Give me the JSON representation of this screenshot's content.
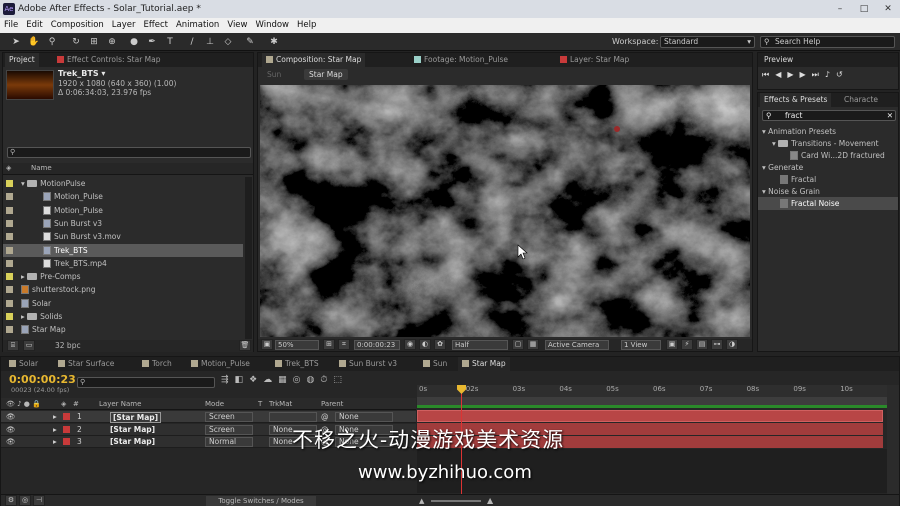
{
  "window": {
    "title": "Adobe After Effects - Solar_Tutorial.aep *",
    "logo": "Ae"
  },
  "menu": [
    "File",
    "Edit",
    "Composition",
    "Layer",
    "Effect",
    "Animation",
    "View",
    "Window",
    "Help"
  ],
  "toolbar": {
    "workspace_label": "Workspace:",
    "workspace_value": "Standard",
    "search_help": "Search Help"
  },
  "project": {
    "tab": "Project",
    "effect_controls_tab": "Effect Controls: Star Map",
    "item_name": "Trek_BTS ▾",
    "item_info1": "1920 x 1080  (640 x 360) (1.00)",
    "item_info2": "Δ 0:06:34:03, 23.976 fps",
    "name_header": "Name",
    "bpc": "32 bpc",
    "items": [
      {
        "label": "MotionPulse",
        "type": "folder",
        "color": "#d8d05a",
        "indent": 0
      },
      {
        "label": "Motion_Pulse",
        "type": "comp",
        "color": "#b0a890",
        "indent": 1
      },
      {
        "label": "Motion_Pulse",
        "type": "file",
        "color": "#b0a890",
        "indent": 1
      },
      {
        "label": "Sun Burst v3",
        "type": "comp",
        "color": "#b0a890",
        "indent": 1
      },
      {
        "label": "Sun Burst v3.mov",
        "type": "file",
        "color": "#b0a890",
        "indent": 1
      },
      {
        "label": "Trek_BTS",
        "type": "comp",
        "color": "#b0a890",
        "indent": 1,
        "selected": true
      },
      {
        "label": "Trek_BTS.mp4",
        "type": "file",
        "color": "#b0a890",
        "indent": 1
      },
      {
        "label": "Pre-Comps",
        "type": "folder",
        "color": "#d8d05a",
        "indent": 0
      },
      {
        "label": "shutterstock.png",
        "type": "image",
        "color": "#b0a890",
        "indent": 0
      },
      {
        "label": "Solar",
        "type": "comp",
        "color": "#b0a890",
        "indent": 0
      },
      {
        "label": "Solids",
        "type": "folder",
        "color": "#d8d05a",
        "indent": 0
      },
      {
        "label": "Star Map",
        "type": "comp",
        "color": "#b0a890",
        "indent": 0
      }
    ]
  },
  "viewer": {
    "comp_tab": "Composition: Star Map",
    "footage_tab": "Footage: Motion_Pulse",
    "layer_tab": "Layer: Star Map",
    "crumbs": [
      "Sun",
      "Star Map"
    ],
    "zoom": "50%",
    "timecode": "0:00:00:23",
    "resolution": "Half",
    "camera": "Active Camera",
    "view": "1 View"
  },
  "preview": {
    "tab": "Preview"
  },
  "effects": {
    "tab": "Effects & Presets",
    "tab2": "Characte",
    "search": "fract",
    "items": [
      "Animation Presets",
      "Transitions - Movement",
      "Card Wi...2D fractured",
      "Generate",
      "Fractal",
      "Noise & Grain",
      "Fractal Noise"
    ]
  },
  "timeline": {
    "tabs": [
      "Solar",
      "Star Surface",
      "Torch",
      "Motion_Pulse",
      "Trek_BTS",
      "Sun Burst v3",
      "Sun",
      "Star Map"
    ],
    "tab_colors": [
      "#b0a890",
      "#b0a890",
      "#b0a890",
      "#b0a890",
      "#b0a890",
      "#b0a890",
      "#b0a890",
      "#b0a890"
    ],
    "timecode": "0:00:00:23",
    "frames": "00023 (24.00 fps)",
    "search_placeholder": "",
    "headers": {
      "layer_name": "Layer Name",
      "mode": "Mode",
      "t": "T",
      "trkmat": "TrkMat",
      "parent": "Parent"
    },
    "ticks": [
      "0s",
      "02s",
      "03s",
      "04s",
      "05s",
      "06s",
      "07s",
      "08s",
      "09s",
      "10s"
    ],
    "layers": [
      {
        "num": "1",
        "name": "[Star Map]",
        "mode": "Screen",
        "trkmat": "",
        "parent": "None"
      },
      {
        "num": "2",
        "name": "[Star Map]",
        "mode": "Screen",
        "trkmat": "None",
        "parent": "None"
      },
      {
        "num": "3",
        "name": "[Star Map]",
        "mode": "Normal",
        "trkmat": "None",
        "parent": "None"
      }
    ],
    "toggle": "Toggle Switches / Modes"
  },
  "watermark": {
    "line1": "不移之火-动漫游戏美术资源",
    "line2": "www.byzhihuo.com"
  }
}
